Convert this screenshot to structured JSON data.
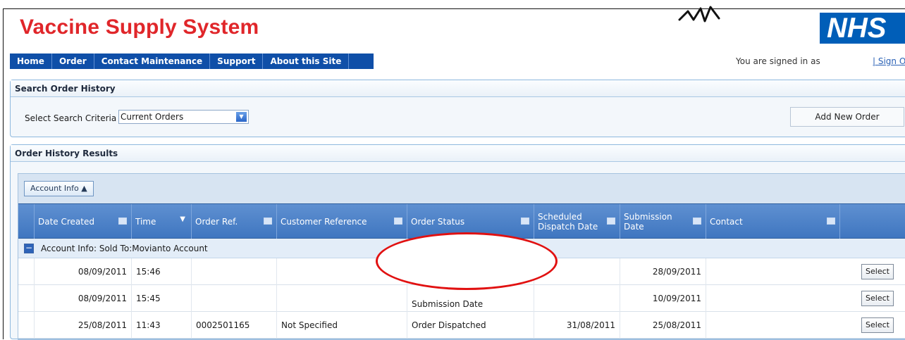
{
  "app": {
    "title": "Vaccine Supply System",
    "logo": "NHS",
    "signed_in_text": "You are signed in as",
    "signout_text": "| Sign O"
  },
  "nav": {
    "items": [
      {
        "label": "Home"
      },
      {
        "label": "Order"
      },
      {
        "label": "Contact Maintenance"
      },
      {
        "label": "Support"
      },
      {
        "label": "About this Site"
      }
    ]
  },
  "search_panel": {
    "title": "Search Order History",
    "criteria_label": "Select Search Criteria",
    "criteria_value": "Current Orders",
    "add_button": "Add New Order"
  },
  "results": {
    "title": "Order History Results",
    "group_chip": "Account Info ▲",
    "columns": [
      "Date Created",
      "Time",
      "Order Ref.",
      "Customer Reference",
      "Order Status",
      "Scheduled Dispatch Date",
      "Submission Date",
      "Contact"
    ],
    "group_label": "Account Info: Sold To:Movianto Account",
    "rows": [
      {
        "date_created": "08/09/2011",
        "time": "15:46",
        "order_ref": "",
        "customer_reference": "",
        "order_status": "",
        "scheduled_dispatch_date": "",
        "submission_date": "28/09/2011",
        "contact": "",
        "select_label": "Select"
      },
      {
        "date_created": "08/09/2011",
        "time": "15:45",
        "order_ref": "",
        "customer_reference": "",
        "order_status": "Submission Date",
        "scheduled_dispatch_date": "",
        "submission_date": "10/09/2011",
        "contact": "",
        "select_label": "Select"
      },
      {
        "date_created": "25/08/2011",
        "time": "11:43",
        "order_ref": "0002501165",
        "customer_reference": "Not Specified",
        "order_status": "Order Dispatched",
        "scheduled_dispatch_date": "31/08/2011",
        "submission_date": "25/08/2011",
        "contact": "",
        "select_label": "Select"
      }
    ]
  },
  "colors": {
    "title_red": "#e0262a",
    "nav_blue": "#0f4fa8",
    "header_blue": "#4f85c9",
    "oval_red": "#e11111"
  },
  "icons": {
    "dropdown": "chevron-down-icon",
    "sort": "sort-icon",
    "collapse": "minus-icon"
  }
}
